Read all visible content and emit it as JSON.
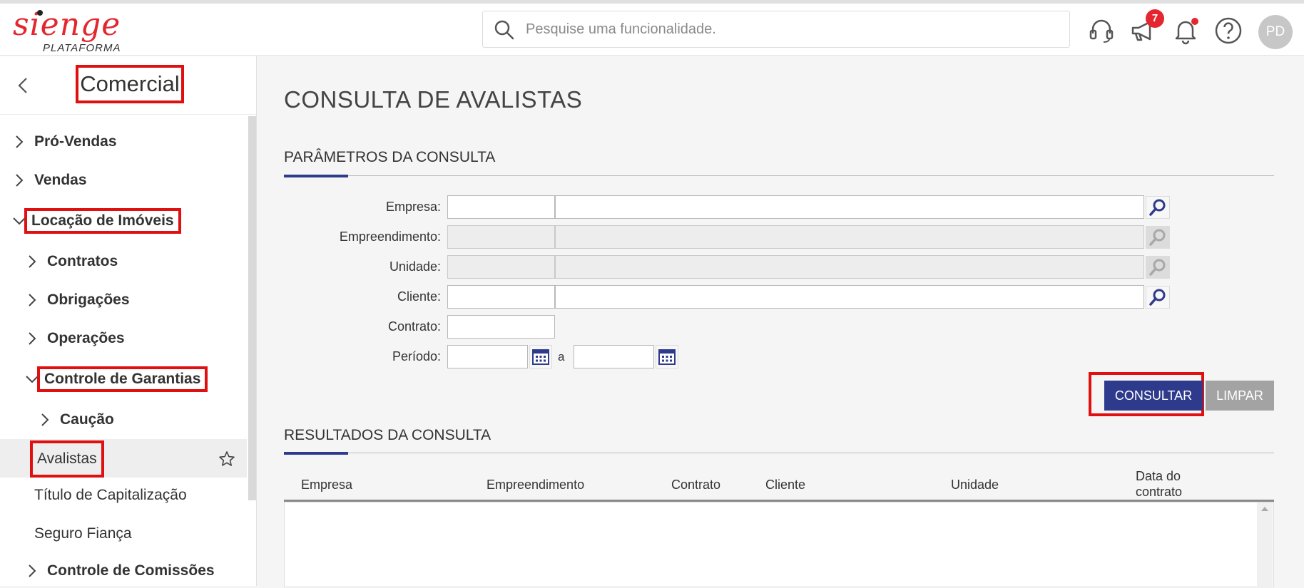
{
  "header": {
    "logo_text": "sienge",
    "logo_sub": "PLATAFORMA",
    "search_placeholder": "Pesquise uma funcionalidade.",
    "announcements_badge": "7",
    "avatar_initials": "PD"
  },
  "sidebar": {
    "title": "Comercial",
    "items": [
      {
        "label": "Pró-Vendas"
      },
      {
        "label": "Vendas"
      },
      {
        "label": "Locação de Imóveis"
      },
      {
        "label": "Contratos"
      },
      {
        "label": "Obrigações"
      },
      {
        "label": "Operações"
      },
      {
        "label": "Controle de Garantias"
      },
      {
        "label": "Caução"
      },
      {
        "label": "Avalistas"
      },
      {
        "label": "Título de Capitalização"
      },
      {
        "label": "Seguro Fiança"
      },
      {
        "label": "Controle de Comissões"
      }
    ]
  },
  "main": {
    "page_title": "CONSULTA DE AVALISTAS",
    "params_title": "PARÂMETROS DA CONSULTA",
    "fields": {
      "empresa": "Empresa:",
      "empreendimento": "Empreendimento:",
      "unidade": "Unidade:",
      "cliente": "Cliente:",
      "contrato": "Contrato:",
      "periodo": "Período:",
      "periodo_sep": "a"
    },
    "buttons": {
      "consultar": "CONSULTAR",
      "limpar": "LIMPAR"
    },
    "results_title": "RESULTADOS DA CONSULTA",
    "columns": [
      "Empresa",
      "Empreendimento",
      "Contrato",
      "Cliente",
      "Unidade",
      "Data do contrato"
    ]
  }
}
